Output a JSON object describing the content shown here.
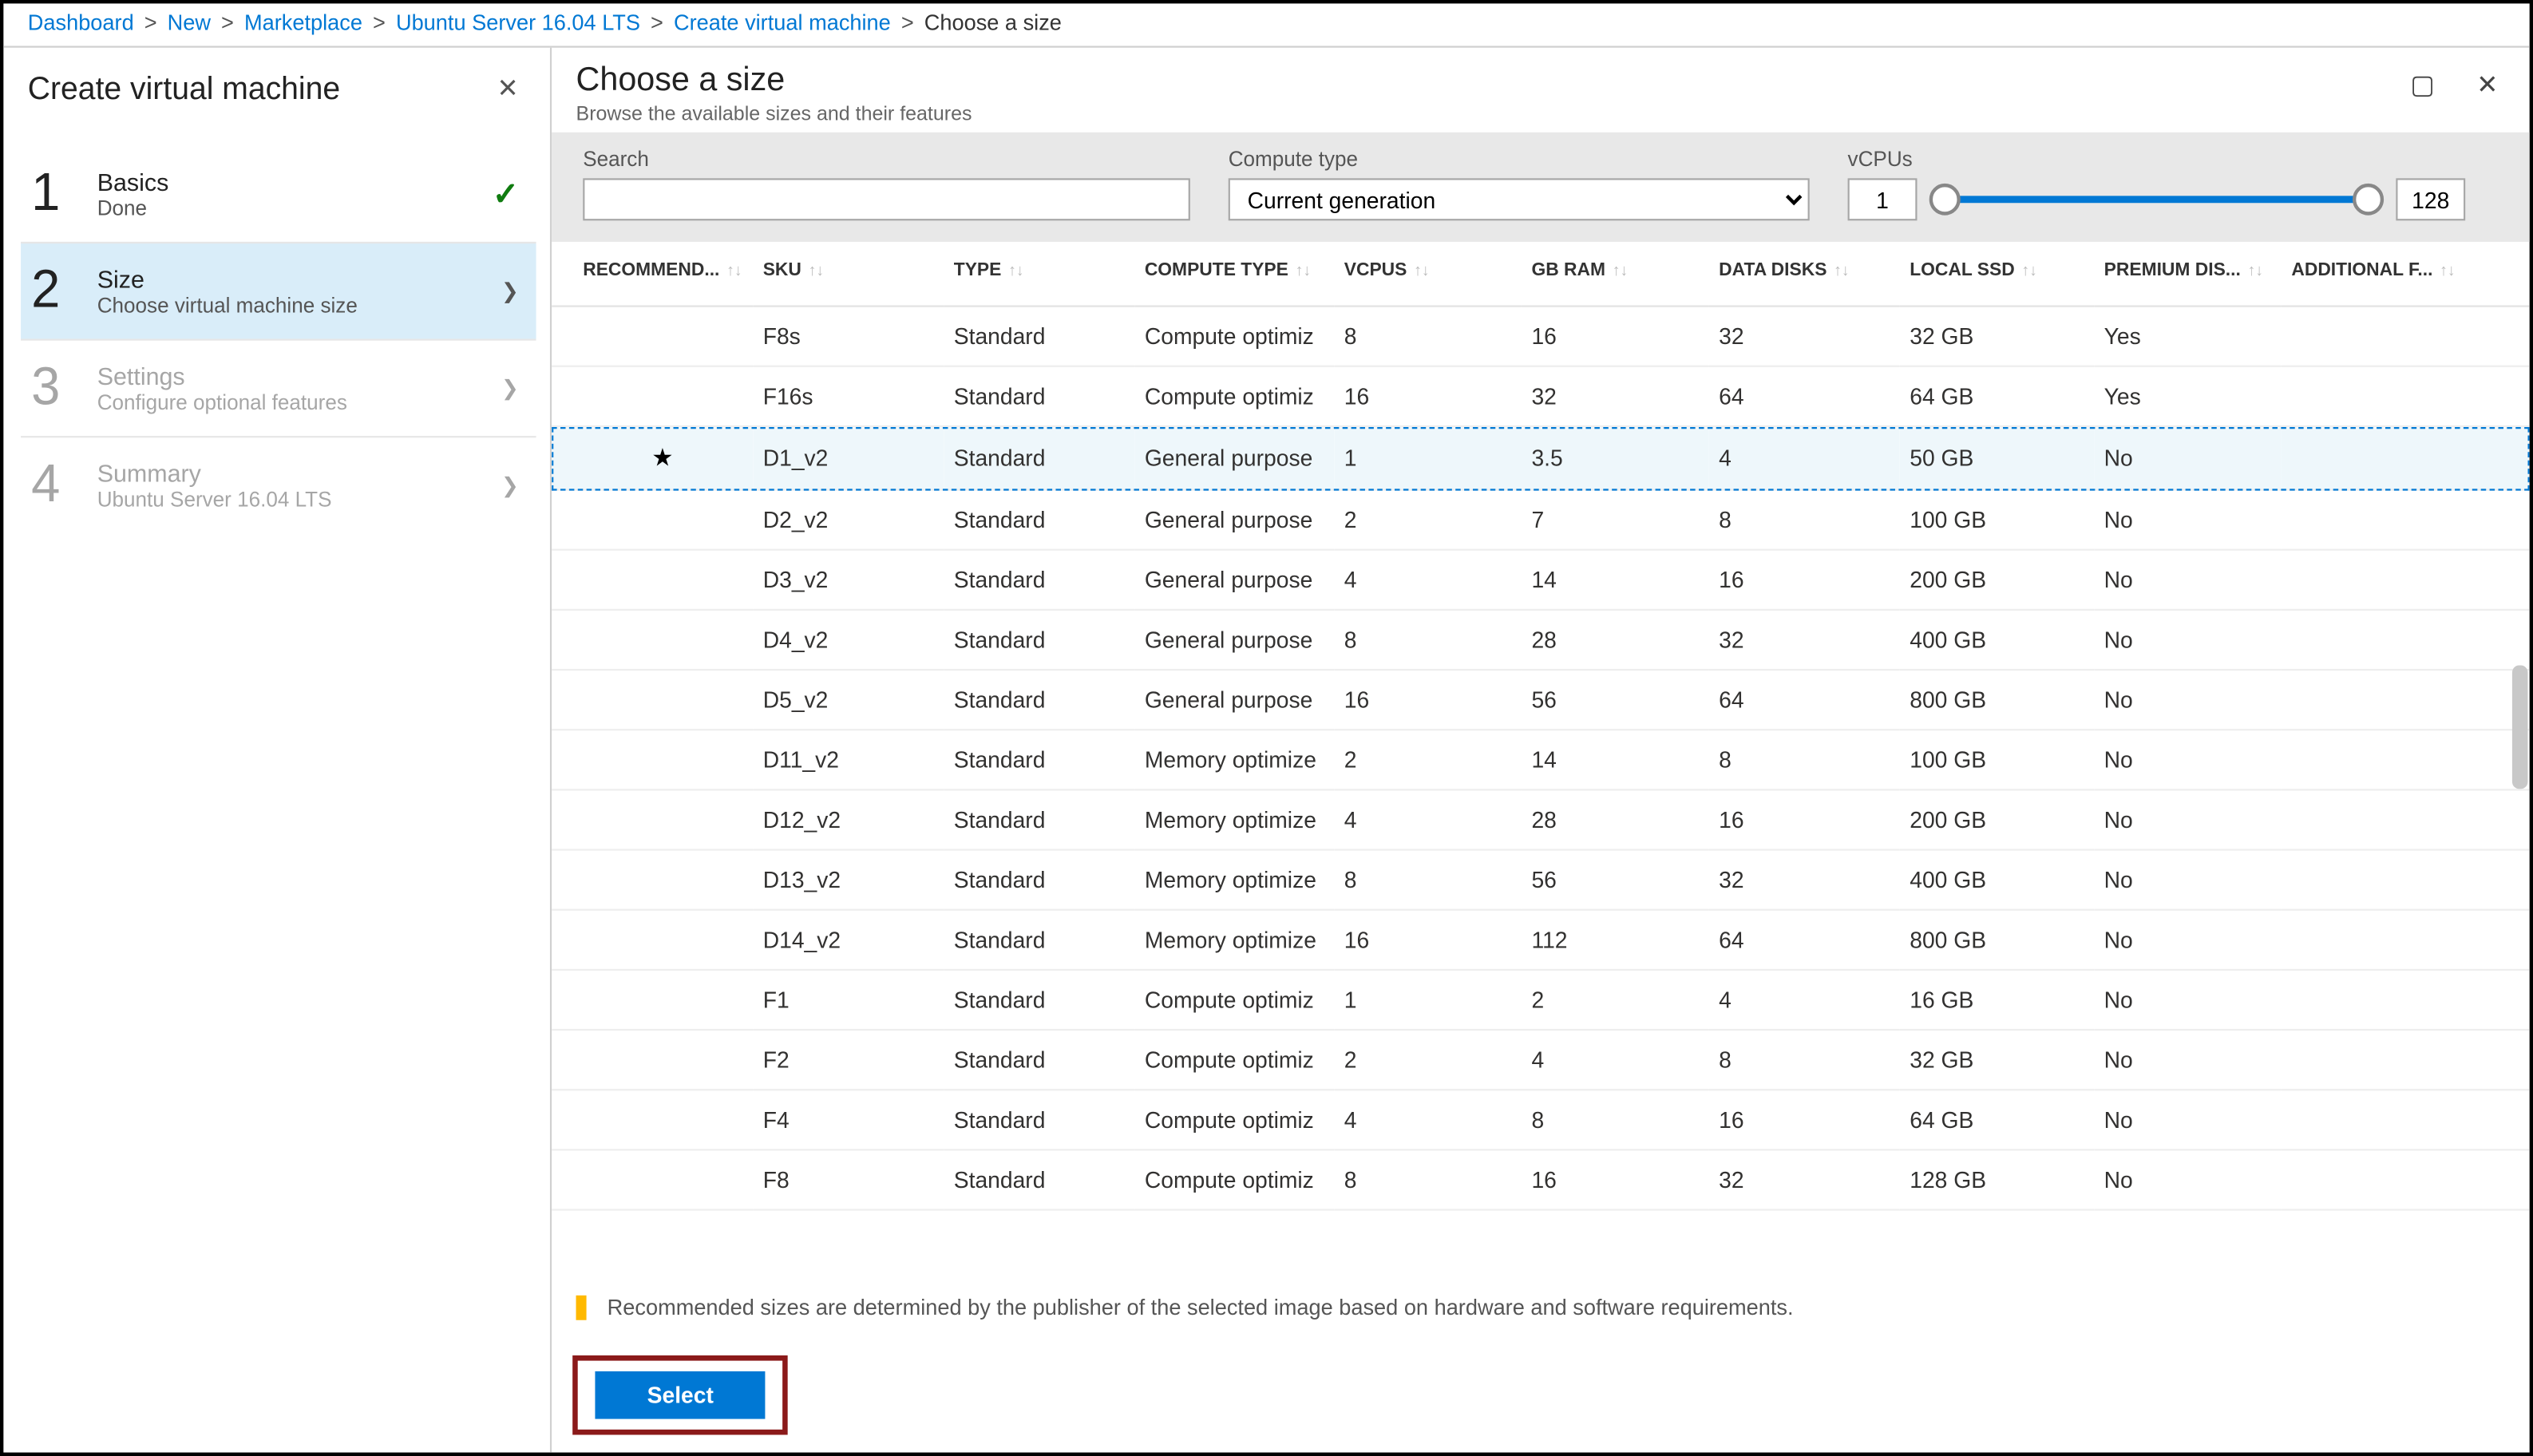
{
  "breadcrumb": {
    "items": [
      "Dashboard",
      "New",
      "Marketplace",
      "Ubuntu Server 16.04 LTS",
      "Create virtual machine"
    ],
    "current": "Choose a size"
  },
  "left_panel": {
    "title": "Create virtual machine",
    "steps": [
      {
        "num": "1",
        "title": "Basics",
        "sub": "Done",
        "state": "done"
      },
      {
        "num": "2",
        "title": "Size",
        "sub": "Choose virtual machine size",
        "state": "active"
      },
      {
        "num": "3",
        "title": "Settings",
        "sub": "Configure optional features",
        "state": "disabled"
      },
      {
        "num": "4",
        "title": "Summary",
        "sub": "Ubuntu Server 16.04 LTS",
        "state": "disabled"
      }
    ]
  },
  "right_panel": {
    "title": "Choose a size",
    "subtitle": "Browse the available sizes and their features",
    "filters": {
      "search_label": "Search",
      "search_value": "",
      "compute_label": "Compute type",
      "compute_value": "Current generation",
      "vcpu_label": "vCPUs",
      "vcpu_min": "1",
      "vcpu_max": "128"
    },
    "columns": [
      "RECOMMEND...",
      "SKU",
      "TYPE",
      "COMPUTE TYPE",
      "VCPUS",
      "GB RAM",
      "DATA DISKS",
      "LOCAL SSD",
      "PREMIUM DIS...",
      "ADDITIONAL F..."
    ],
    "rows": [
      {
        "rec": "",
        "sku": "F8s",
        "type": "Standard",
        "ct": "Compute optimiz",
        "vcpu": "8",
        "ram": "16",
        "dd": "32",
        "ssd": "32 GB",
        "prem": "Yes",
        "add": "",
        "selected": false
      },
      {
        "rec": "",
        "sku": "F16s",
        "type": "Standard",
        "ct": "Compute optimiz",
        "vcpu": "16",
        "ram": "32",
        "dd": "64",
        "ssd": "64 GB",
        "prem": "Yes",
        "add": "",
        "selected": false
      },
      {
        "rec": "★",
        "sku": "D1_v2",
        "type": "Standard",
        "ct": "General purpose",
        "vcpu": "1",
        "ram": "3.5",
        "dd": "4",
        "ssd": "50 GB",
        "prem": "No",
        "add": "",
        "selected": true
      },
      {
        "rec": "",
        "sku": "D2_v2",
        "type": "Standard",
        "ct": "General purpose",
        "vcpu": "2",
        "ram": "7",
        "dd": "8",
        "ssd": "100 GB",
        "prem": "No",
        "add": "",
        "selected": false
      },
      {
        "rec": "",
        "sku": "D3_v2",
        "type": "Standard",
        "ct": "General purpose",
        "vcpu": "4",
        "ram": "14",
        "dd": "16",
        "ssd": "200 GB",
        "prem": "No",
        "add": "",
        "selected": false
      },
      {
        "rec": "",
        "sku": "D4_v2",
        "type": "Standard",
        "ct": "General purpose",
        "vcpu": "8",
        "ram": "28",
        "dd": "32",
        "ssd": "400 GB",
        "prem": "No",
        "add": "",
        "selected": false
      },
      {
        "rec": "",
        "sku": "D5_v2",
        "type": "Standard",
        "ct": "General purpose",
        "vcpu": "16",
        "ram": "56",
        "dd": "64",
        "ssd": "800 GB",
        "prem": "No",
        "add": "",
        "selected": false
      },
      {
        "rec": "",
        "sku": "D11_v2",
        "type": "Standard",
        "ct": "Memory optimize",
        "vcpu": "2",
        "ram": "14",
        "dd": "8",
        "ssd": "100 GB",
        "prem": "No",
        "add": "",
        "selected": false
      },
      {
        "rec": "",
        "sku": "D12_v2",
        "type": "Standard",
        "ct": "Memory optimize",
        "vcpu": "4",
        "ram": "28",
        "dd": "16",
        "ssd": "200 GB",
        "prem": "No",
        "add": "",
        "selected": false
      },
      {
        "rec": "",
        "sku": "D13_v2",
        "type": "Standard",
        "ct": "Memory optimize",
        "vcpu": "8",
        "ram": "56",
        "dd": "32",
        "ssd": "400 GB",
        "prem": "No",
        "add": "",
        "selected": false
      },
      {
        "rec": "",
        "sku": "D14_v2",
        "type": "Standard",
        "ct": "Memory optimize",
        "vcpu": "16",
        "ram": "112",
        "dd": "64",
        "ssd": "800 GB",
        "prem": "No",
        "add": "",
        "selected": false
      },
      {
        "rec": "",
        "sku": "F1",
        "type": "Standard",
        "ct": "Compute optimiz",
        "vcpu": "1",
        "ram": "2",
        "dd": "4",
        "ssd": "16 GB",
        "prem": "No",
        "add": "",
        "selected": false
      },
      {
        "rec": "",
        "sku": "F2",
        "type": "Standard",
        "ct": "Compute optimiz",
        "vcpu": "2",
        "ram": "4",
        "dd": "8",
        "ssd": "32 GB",
        "prem": "No",
        "add": "",
        "selected": false
      },
      {
        "rec": "",
        "sku": "F4",
        "type": "Standard",
        "ct": "Compute optimiz",
        "vcpu": "4",
        "ram": "8",
        "dd": "16",
        "ssd": "64 GB",
        "prem": "No",
        "add": "",
        "selected": false
      },
      {
        "rec": "",
        "sku": "F8",
        "type": "Standard",
        "ct": "Compute optimiz",
        "vcpu": "8",
        "ram": "16",
        "dd": "32",
        "ssd": "128 GB",
        "prem": "No",
        "add": "",
        "selected": false
      }
    ],
    "info_note": "Recommended sizes are determined by the publisher of the selected image based on hardware and software requirements.",
    "select_button": "Select"
  }
}
